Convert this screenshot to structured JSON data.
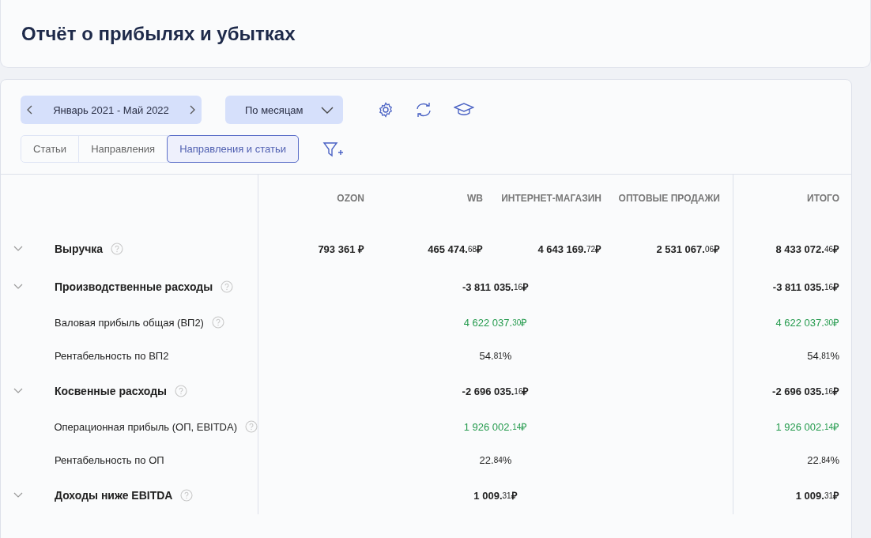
{
  "page_title": "Отчёт о прибылях и убытках",
  "period": {
    "label": "Январь 2021 - Май 2022"
  },
  "grouping": {
    "label": "По месяцам"
  },
  "view_tabs": [
    {
      "label": "Статьи",
      "selected": false
    },
    {
      "label": "Направления",
      "selected": false
    },
    {
      "label": "Направления и статьи",
      "selected": true
    }
  ],
  "table": {
    "columns": [
      "OZON",
      "WB",
      "ИНТЕРНЕТ-МАГАЗИН",
      "ОПТОВЫЕ ПРОДАЖИ"
    ],
    "total_column": "ИТОГО",
    "rows": [
      {
        "kind": "group",
        "label": "Выручка",
        "expanded": true,
        "help": true,
        "positive": false,
        "values": [
          {
            "main": "793 361",
            "unit": "₽"
          },
          {
            "main": "465 474.",
            "frac": "68",
            "unit": "₽"
          },
          {
            "main": "4 643 169.",
            "frac": "72",
            "unit": "₽"
          },
          {
            "main": "2 531 067.",
            "frac": "06",
            "unit": "₽"
          }
        ],
        "total": {
          "main": "8 433 072.",
          "frac": "46",
          "unit": "₽"
        }
      },
      {
        "kind": "group",
        "label": "Производственные расходы",
        "expanded": true,
        "help": true,
        "positive": false,
        "merged_value": {
          "main": "-3 811 035.",
          "frac": "16",
          "unit": "₽"
        },
        "total": {
          "main": "-3 811 035.",
          "frac": "16",
          "unit": "₽"
        }
      },
      {
        "kind": "metric",
        "label": "Валовая прибыль общая (ВП2)",
        "help": true,
        "positive": true,
        "merged_value": {
          "main": "4 622 037.",
          "frac": "30",
          "unit": "₽"
        },
        "total": {
          "main": "4 622 037.",
          "frac": "30",
          "unit": "₽"
        }
      },
      {
        "kind": "metric",
        "label": "Рентабельность по ВП2",
        "help": false,
        "positive": false,
        "merged_value": {
          "main": "54.",
          "frac": "81",
          "unit": "%"
        },
        "total": {
          "main": "54.",
          "frac": "81",
          "unit": "%"
        }
      },
      {
        "kind": "group",
        "label": "Косвенные расходы",
        "expanded": true,
        "help": true,
        "positive": false,
        "merged_value": {
          "main": "-2 696 035.",
          "frac": "16",
          "unit": "₽"
        },
        "total": {
          "main": "-2 696 035.",
          "frac": "16",
          "unit": "₽"
        }
      },
      {
        "kind": "metric",
        "label": "Операционная прибыль (ОП, EBITDA)",
        "help": true,
        "positive": true,
        "merged_value": {
          "main": "1 926 002.",
          "frac": "14",
          "unit": "₽"
        },
        "total": {
          "main": "1 926 002.",
          "frac": "14",
          "unit": "₽"
        }
      },
      {
        "kind": "metric",
        "label": "Рентабельность по ОП",
        "help": false,
        "positive": false,
        "merged_value": {
          "main": "22.",
          "frac": "84",
          "unit": "%"
        },
        "total": {
          "main": "22.",
          "frac": "84",
          "unit": "%"
        }
      },
      {
        "kind": "group",
        "label": "Доходы ниже EBITDA",
        "expanded": true,
        "help": true,
        "positive": false,
        "merged_value": {
          "main": "1 009.",
          "frac": "31",
          "unit": "₽"
        },
        "total": {
          "main": "1 009.",
          "frac": "31",
          "unit": "₽"
        }
      }
    ]
  }
}
